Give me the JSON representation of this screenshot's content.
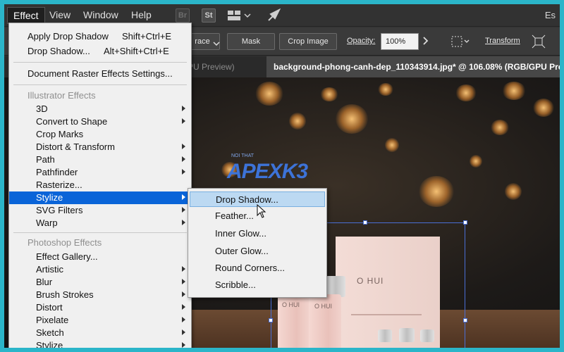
{
  "menubar": {
    "items": [
      "Effect",
      "View",
      "Window",
      "Help"
    ],
    "apps": [
      "Br",
      "St"
    ],
    "right_text": "Es"
  },
  "controlbar": {
    "trace_label": "race",
    "mask_label": "Mask",
    "crop_label": "Crop Image",
    "opacity_label": "Opacity:",
    "opacity_value": "100%",
    "transform_label": "Transform"
  },
  "tabs": {
    "inactive": "PU Preview)",
    "active": "background-phong-canh-dep_110343914.jpg* @ 106.08% (RGB/GPU Pre"
  },
  "canvas": {
    "watermark": "APEXK3",
    "watermark_sub": "NOI THAT",
    "product_brand": "O HUI"
  },
  "effect_menu": {
    "apply_drop_shadow": "Apply Drop Shadow",
    "apply_drop_shadow_shortcut": "Shift+Ctrl+E",
    "drop_shadow": "Drop Shadow...",
    "drop_shadow_shortcut": "Alt+Shift+Ctrl+E",
    "doc_raster": "Document Raster Effects Settings...",
    "illustrator_header": "Illustrator Effects",
    "illustrator_items": [
      "3D",
      "Convert to Shape",
      "Crop Marks",
      "Distort & Transform",
      "Path",
      "Pathfinder",
      "Rasterize...",
      "Stylize",
      "SVG Filters",
      "Warp"
    ],
    "photoshop_header": "Photoshop Effects",
    "photoshop_items": [
      "Effect Gallery...",
      "Artistic",
      "Blur",
      "Brush Strokes",
      "Distort",
      "Pixelate",
      "Sketch",
      "Stylize"
    ]
  },
  "stylize_submenu": {
    "items": [
      "Drop Shadow...",
      "Feather...",
      "Inner Glow...",
      "Outer Glow...",
      "Round Corners...",
      "Scribble..."
    ]
  }
}
